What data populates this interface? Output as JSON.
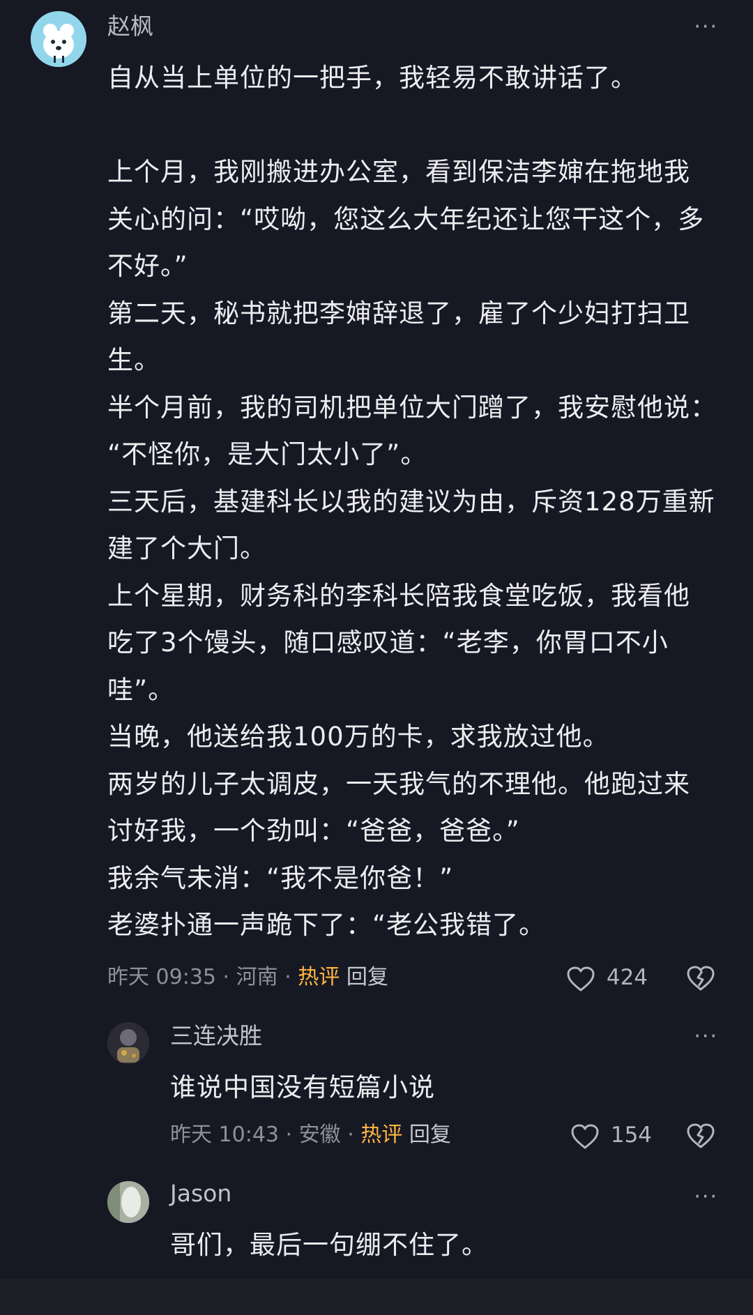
{
  "main_comment": {
    "author": "赵枫",
    "lines": [
      "自从当上单位的一把手，我轻易不敢讲话了。",
      "",
      "上个月，我刚搬进办公室，看到保洁李婶在拖地我",
      "关心的问：“哎呦，您这么大年纪还让您干这个，多",
      "不好。”",
      "第二天，秘书就把李婶辞退了，雇了个少妇打扫卫",
      "生。",
      "半个月前，我的司机把单位大门蹭了，我安慰他说：",
      "“不怪你，是大门太小了”。",
      "三天后，基建科长以我的建议为由，斥资128万重新",
      "建了个大门。",
      "上个星期，财务科的李科长陪我食堂吃饭，我看他",
      "吃了3个馒头，随口感叹道：“老李，你胃口不小",
      "哇”。",
      "当晚，他送给我100万的卡，求我放过他。",
      "两岁的儿子太调皮，一天我气的不理他。他跑过来",
      "讨好我，一个劲叫：“爸爸，爸爸。”",
      "我余气未消：“我不是你爸！”",
      "老婆扑通一声跪下了：“老公我错了。"
    ],
    "time": "昨天 09:35",
    "location": "河南",
    "hot_label": "热评",
    "reply_label": "回复",
    "likes": "424",
    "separator": "·"
  },
  "replies": [
    {
      "author": "三连决胜",
      "text": "谁说中国没有短篇小说",
      "time": "昨天 10:43",
      "location": "安徽",
      "hot_label": "热评",
      "reply_label": "回复",
      "likes": "154",
      "separator": "·"
    },
    {
      "author": "Jason",
      "text": "哥们，最后一句绷不住了。"
    }
  ],
  "icons": {
    "more": "more-dots-icon",
    "like": "heart-icon",
    "dislike": "broken-heart-icon"
  },
  "colors": {
    "background": "#161823",
    "hot": "#ffb640",
    "text": "#ededf0",
    "meta": "#8f9099"
  }
}
